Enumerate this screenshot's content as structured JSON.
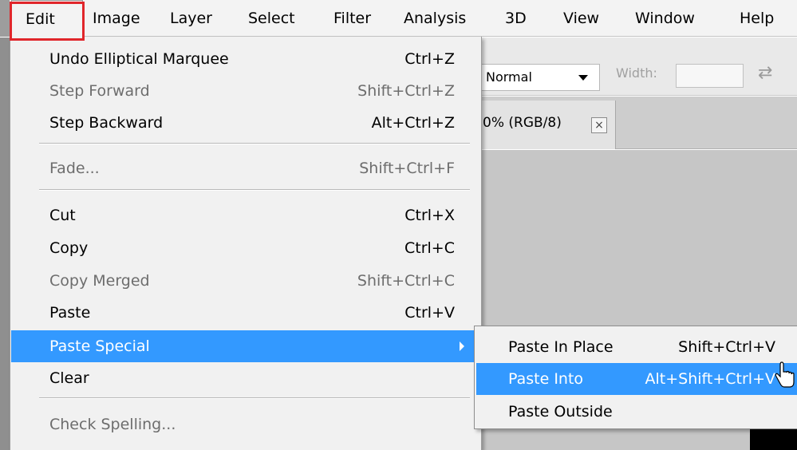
{
  "menubar": {
    "items": [
      "Edit",
      "Image",
      "Layer",
      "Select",
      "Filter",
      "Analysis",
      "3D",
      "View",
      "Window",
      "Help"
    ]
  },
  "options_bar": {
    "style_value": "Normal",
    "width_label": "Width:"
  },
  "document_tab": {
    "label": "0% (RGB/8)",
    "close_glyph": "×"
  },
  "edit_menu": {
    "undo": {
      "label": "Undo Elliptical Marquee",
      "shortcut": "Ctrl+Z"
    },
    "step_forward": {
      "label": "Step Forward",
      "shortcut": "Shift+Ctrl+Z"
    },
    "step_backward": {
      "label": "Step Backward",
      "shortcut": "Alt+Ctrl+Z"
    },
    "fade": {
      "label": "Fade...",
      "shortcut": "Shift+Ctrl+F"
    },
    "cut": {
      "label": "Cut",
      "shortcut": "Ctrl+X"
    },
    "copy": {
      "label": "Copy",
      "shortcut": "Ctrl+C"
    },
    "copy_merged": {
      "label": "Copy Merged",
      "shortcut": "Shift+Ctrl+C"
    },
    "paste": {
      "label": "Paste",
      "shortcut": "Ctrl+V"
    },
    "paste_special": {
      "label": "Paste Special"
    },
    "clear": {
      "label": "Clear"
    },
    "check_spelling": {
      "label": "Check Spelling..."
    }
  },
  "paste_special_menu": {
    "paste_in_place": {
      "label": "Paste In Place",
      "shortcut": "Shift+Ctrl+V"
    },
    "paste_into": {
      "label": "Paste Into",
      "shortcut": "Alt+Shift+Ctrl+V"
    },
    "paste_outside": {
      "label": "Paste Outside"
    }
  },
  "colors": {
    "selection": "#3399ff",
    "highlight_box": "#e0262b",
    "menu_background": "#f1f1f1",
    "disabled_text": "#6d6d6d"
  },
  "icons": {
    "swap": "swap-icon",
    "submenu_arrow": "chevron-right-icon",
    "cursor": "mouse-pointer-icon",
    "dropdown": "chevron-down-icon"
  }
}
